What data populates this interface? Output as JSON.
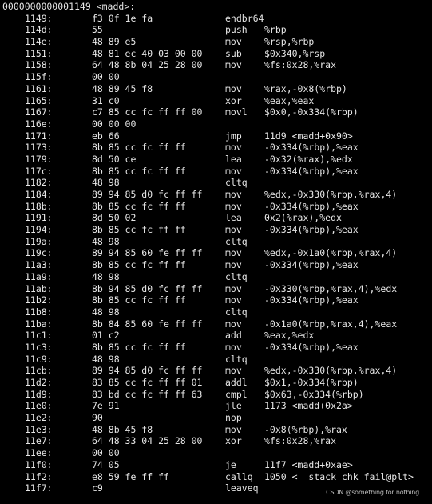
{
  "header": "0000000000001149 <madd>:",
  "rows": [
    [
      "1149:",
      "f3 0f 1e fa",
      "endbr64",
      ""
    ],
    [
      "114d:",
      "55",
      "push",
      "%rbp"
    ],
    [
      "114e:",
      "48 89 e5",
      "mov",
      "%rsp,%rbp"
    ],
    [
      "1151:",
      "48 81 ec 40 03 00 00",
      "sub",
      "$0x340,%rsp"
    ],
    [
      "1158:",
      "64 48 8b 04 25 28 00",
      "mov",
      "%fs:0x28,%rax"
    ],
    [
      "115f:",
      "00 00",
      "",
      ""
    ],
    [
      "1161:",
      "48 89 45 f8",
      "mov",
      "%rax,-0x8(%rbp)"
    ],
    [
      "1165:",
      "31 c0",
      "xor",
      "%eax,%eax"
    ],
    [
      "1167:",
      "c7 85 cc fc ff ff 00",
      "movl",
      "$0x0,-0x334(%rbp)"
    ],
    [
      "116e:",
      "00 00 00",
      "",
      ""
    ],
    [
      "1171:",
      "eb 66",
      "jmp",
      "11d9 <madd+0x90>"
    ],
    [
      "1173:",
      "8b 85 cc fc ff ff",
      "mov",
      "-0x334(%rbp),%eax"
    ],
    [
      "1179:",
      "8d 50 ce",
      "lea",
      "-0x32(%rax),%edx"
    ],
    [
      "117c:",
      "8b 85 cc fc ff ff",
      "mov",
      "-0x334(%rbp),%eax"
    ],
    [
      "1182:",
      "48 98",
      "cltq",
      ""
    ],
    [
      "1184:",
      "89 94 85 d0 fc ff ff",
      "mov",
      "%edx,-0x330(%rbp,%rax,4)"
    ],
    [
      "118b:",
      "8b 85 cc fc ff ff",
      "mov",
      "-0x334(%rbp),%eax"
    ],
    [
      "1191:",
      "8d 50 02",
      "lea",
      "0x2(%rax),%edx"
    ],
    [
      "1194:",
      "8b 85 cc fc ff ff",
      "mov",
      "-0x334(%rbp),%eax"
    ],
    [
      "119a:",
      "48 98",
      "cltq",
      ""
    ],
    [
      "119c:",
      "89 94 85 60 fe ff ff",
      "mov",
      "%edx,-0x1a0(%rbp,%rax,4)"
    ],
    [
      "11a3:",
      "8b 85 cc fc ff ff",
      "mov",
      "-0x334(%rbp),%eax"
    ],
    [
      "11a9:",
      "48 98",
      "cltq",
      ""
    ],
    [
      "11ab:",
      "8b 94 85 d0 fc ff ff",
      "mov",
      "-0x330(%rbp,%rax,4),%edx"
    ],
    [
      "11b2:",
      "8b 85 cc fc ff ff",
      "mov",
      "-0x334(%rbp),%eax"
    ],
    [
      "11b8:",
      "48 98",
      "cltq",
      ""
    ],
    [
      "11ba:",
      "8b 84 85 60 fe ff ff",
      "mov",
      "-0x1a0(%rbp,%rax,4),%eax"
    ],
    [
      "11c1:",
      "01 c2",
      "add",
      "%eax,%edx"
    ],
    [
      "11c3:",
      "8b 85 cc fc ff ff",
      "mov",
      "-0x334(%rbp),%eax"
    ],
    [
      "11c9:",
      "48 98",
      "cltq",
      ""
    ],
    [
      "11cb:",
      "89 94 85 d0 fc ff ff",
      "mov",
      "%edx,-0x330(%rbp,%rax,4)"
    ],
    [
      "11d2:",
      "83 85 cc fc ff ff 01",
      "addl",
      "$0x1,-0x334(%rbp)"
    ],
    [
      "11d9:",
      "83 bd cc fc ff ff 63",
      "cmpl",
      "$0x63,-0x334(%rbp)"
    ],
    [
      "11e0:",
      "7e 91",
      "jle",
      "1173 <madd+0x2a>"
    ],
    [
      "11e2:",
      "90",
      "nop",
      ""
    ],
    [
      "11e3:",
      "48 8b 45 f8",
      "mov",
      "-0x8(%rbp),%rax"
    ],
    [
      "11e7:",
      "64 48 33 04 25 28 00",
      "xor",
      "%fs:0x28,%rax"
    ],
    [
      "11ee:",
      "00 00",
      "",
      ""
    ],
    [
      "11f0:",
      "74 05",
      "je",
      "11f7 <madd+0xae>"
    ],
    [
      "11f2:",
      "e8 59 fe ff ff",
      "callq",
      "1050 <__stack_chk_fail@plt>"
    ],
    [
      "11f7:",
      "c9",
      "leaveq",
      ""
    ]
  ],
  "watermark": "CSDN @something  for  nothing"
}
